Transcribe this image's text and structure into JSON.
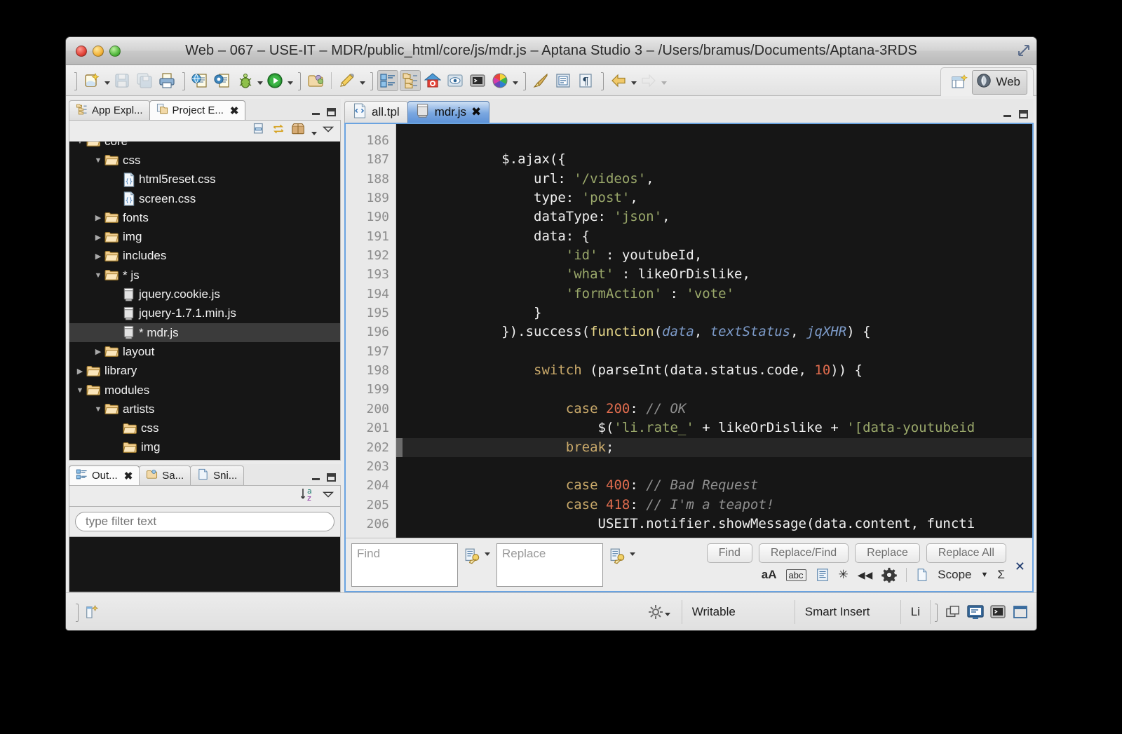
{
  "window": {
    "title": "Web – 067 – USE-IT – MDR/public_html/core/js/mdr.js – Aptana Studio 3 – /Users/bramus/Documents/Aptana-3RDS"
  },
  "toolbar": {
    "left_groups": [
      {
        "items": [
          {
            "name": "new-wizard-icon",
            "label": "New",
            "dropdown": true,
            "enabled": true
          },
          {
            "name": "save-icon",
            "label": "Save",
            "dropdown": false,
            "enabled": false
          },
          {
            "name": "save-all-icon",
            "label": "Save All",
            "dropdown": false,
            "enabled": false
          },
          {
            "name": "print-icon",
            "label": "Print",
            "dropdown": false,
            "enabled": true
          }
        ]
      },
      {
        "items": [
          {
            "name": "run-in-browser-icon",
            "label": "Run in Browser",
            "dropdown": false,
            "enabled": true
          },
          {
            "name": "preview-icon",
            "label": "Preview",
            "dropdown": false,
            "enabled": true
          },
          {
            "name": "debug-icon",
            "label": "Debug",
            "dropdown": true,
            "enabled": true
          },
          {
            "name": "run-icon",
            "label": "Run",
            "dropdown": true,
            "enabled": true
          }
        ]
      },
      {
        "items": [
          {
            "name": "open-resource-icon",
            "label": "Open Resource",
            "dropdown": false,
            "enabled": true
          }
        ]
      },
      {
        "items": [
          {
            "name": "pencil-icon",
            "label": "Edit",
            "dropdown": true,
            "enabled": true
          }
        ]
      },
      {
        "items": [
          {
            "name": "app-explorer-toggle-icon",
            "label": "App Explorer",
            "dropdown": false,
            "enabled": true,
            "pressed": true
          },
          {
            "name": "project-explorer-toggle-icon",
            "label": "Project Explorer",
            "dropdown": false,
            "enabled": true,
            "pressed": true
          },
          {
            "name": "home-icon",
            "label": "Studio Home",
            "dropdown": false,
            "enabled": true
          },
          {
            "name": "preview-pane-icon",
            "label": "Preview Pane",
            "dropdown": false,
            "enabled": true
          },
          {
            "name": "terminal-icon",
            "label": "Terminal",
            "dropdown": false,
            "enabled": true
          },
          {
            "name": "color-wheel-icon",
            "label": "Colors",
            "dropdown": true,
            "enabled": true
          }
        ]
      },
      {
        "items": [
          {
            "name": "brush-icon",
            "label": "Brush",
            "dropdown": false,
            "enabled": true
          },
          {
            "name": "book-icon",
            "label": "Snippets",
            "dropdown": false,
            "enabled": true
          },
          {
            "name": "pilcrow-icon",
            "label": "Show Whitespace",
            "dropdown": false,
            "enabled": true
          }
        ]
      },
      {
        "items": [
          {
            "name": "back-icon",
            "label": "Back",
            "dropdown": true,
            "enabled": true
          },
          {
            "name": "forward-icon",
            "label": "Forward",
            "dropdown": true,
            "enabled": false
          }
        ]
      }
    ],
    "perspective": {
      "open_perspective_icon": "open-perspective-icon",
      "active_label": "Web",
      "active_icon": "web-perspective-icon"
    }
  },
  "explorer": {
    "tabs": [
      {
        "label": "App Expl...",
        "icon": "app-explorer-icon",
        "active": false,
        "closable": false
      },
      {
        "label": "Project E...",
        "icon": "project-explorer-icon",
        "active": true,
        "closable": true
      }
    ],
    "view_toolbar": [
      {
        "name": "collapse-all-icon",
        "label": "Collapse All"
      },
      {
        "name": "link-with-editor-icon",
        "label": "Link with Editor"
      },
      {
        "name": "deploy-icon",
        "label": "Deploy",
        "dropdown": true
      },
      {
        "name": "view-menu-icon",
        "label": "View Menu"
      }
    ],
    "tree": [
      {
        "label": "core",
        "depth": 2,
        "type": "folder",
        "state": "expanded",
        "clipped": true
      },
      {
        "label": "css",
        "depth": 3,
        "type": "folder",
        "state": "expanded"
      },
      {
        "label": "html5reset.css",
        "depth": 4,
        "type": "css-file"
      },
      {
        "label": "screen.css",
        "depth": 4,
        "type": "css-file"
      },
      {
        "label": "fonts",
        "depth": 3,
        "type": "folder",
        "state": "collapsed"
      },
      {
        "label": "img",
        "depth": 3,
        "type": "folder",
        "state": "collapsed"
      },
      {
        "label": "includes",
        "depth": 3,
        "type": "folder",
        "state": "collapsed"
      },
      {
        "label": "* js",
        "depth": 3,
        "type": "folder",
        "state": "expanded"
      },
      {
        "label": "jquery.cookie.js",
        "depth": 4,
        "type": "js-file"
      },
      {
        "label": "jquery-1.7.1.min.js",
        "depth": 4,
        "type": "js-file"
      },
      {
        "label": "* mdr.js",
        "depth": 4,
        "type": "js-file",
        "selected": true
      },
      {
        "label": "layout",
        "depth": 3,
        "type": "folder",
        "state": "collapsed"
      },
      {
        "label": "library",
        "depth": 2,
        "type": "folder",
        "state": "collapsed"
      },
      {
        "label": "modules",
        "depth": 2,
        "type": "folder",
        "state": "expanded"
      },
      {
        "label": "artists",
        "depth": 3,
        "type": "folder",
        "state": "expanded"
      },
      {
        "label": "css",
        "depth": 4,
        "type": "folder",
        "state": "leaf"
      },
      {
        "label": "img",
        "depth": 4,
        "type": "folder",
        "state": "leaf",
        "clipped": true
      }
    ]
  },
  "outline": {
    "tabs": [
      {
        "label": "Out...",
        "icon": "outline-icon",
        "active": true,
        "closable": true
      },
      {
        "label": "Sa...",
        "icon": "samples-icon",
        "active": false,
        "closable": false
      },
      {
        "label": "Sni...",
        "icon": "snippets-icon",
        "active": false,
        "closable": false
      }
    ],
    "view_toolbar": [
      {
        "name": "sort-az-icon",
        "label": "Sort"
      },
      {
        "name": "view-menu-icon",
        "label": "View Menu"
      }
    ],
    "filter_placeholder": "type filter text",
    "filter_value": ""
  },
  "editor": {
    "tabs": [
      {
        "label": "all.tpl",
        "icon": "tpl-file-icon",
        "active": false,
        "closable": false
      },
      {
        "label": "mdr.js",
        "icon": "js-file-icon",
        "active": true,
        "closable": true
      }
    ],
    "first_line": 186,
    "highlighted_line": 202,
    "lines": [
      {
        "num": 186,
        "text": ""
      },
      {
        "num": 187,
        "text": "            $.ajax({"
      },
      {
        "num": 188,
        "text": "                url: '/videos',"
      },
      {
        "num": 189,
        "text": "                type: 'post',"
      },
      {
        "num": 190,
        "text": "                dataType: 'json',"
      },
      {
        "num": 191,
        "text": "                data: {"
      },
      {
        "num": 192,
        "text": "                    'id' : youtubeId,"
      },
      {
        "num": 193,
        "text": "                    'what' : likeOrDislike,"
      },
      {
        "num": 194,
        "text": "                    'formAction' : 'vote'"
      },
      {
        "num": 195,
        "text": "                }"
      },
      {
        "num": 196,
        "text": "            }).success(function(data, textStatus, jqXHR) {"
      },
      {
        "num": 197,
        "text": ""
      },
      {
        "num": 198,
        "text": "                switch (parseInt(data.status.code, 10)) {"
      },
      {
        "num": 199,
        "text": ""
      },
      {
        "num": 200,
        "text": "                    case 200: // OK"
      },
      {
        "num": 201,
        "text": "                        $('li.rate_' + likeOrDislike + '[data-youtubeid"
      },
      {
        "num": 202,
        "text": "                    break;"
      },
      {
        "num": 203,
        "text": ""
      },
      {
        "num": 204,
        "text": "                    case 400: // Bad Request"
      },
      {
        "num": 205,
        "text": "                    case 418: // I'm a teapot!"
      },
      {
        "num": 206,
        "text": "                        USEIT.notifier.showMessage(data.content, functi"
      }
    ]
  },
  "find": {
    "find_placeholder": "Find",
    "find_value": "",
    "replace_placeholder": "Replace",
    "replace_value": "",
    "buttons": [
      {
        "label": "Find",
        "name": "find-button"
      },
      {
        "label": "Replace/Find",
        "name": "replace-find-button"
      },
      {
        "label": "Replace",
        "name": "replace-button"
      },
      {
        "label": "Replace All",
        "name": "replace-all-button"
      }
    ],
    "options": [
      {
        "name": "case-sensitive-icon",
        "glyph": "aA"
      },
      {
        "name": "whole-word-icon",
        "glyph": "abc"
      },
      {
        "name": "search-in-selection-icon",
        "glyph": "▤"
      },
      {
        "name": "regex-icon",
        "glyph": "✳"
      },
      {
        "name": "search-backward-icon",
        "glyph": "◀◀"
      },
      {
        "name": "find-options-icon",
        "glyph": "⚙"
      }
    ],
    "scope_label": "Scope",
    "scope_sigma": "Σ",
    "close_glyph": "✕"
  },
  "statusbar": {
    "left_icon": "editor-marker-icon",
    "settings_icon": "settings-gear-icon",
    "cells": [
      "Writable",
      "Smart Insert",
      "Li"
    ],
    "right_icons": [
      {
        "name": "restore-views-icon"
      },
      {
        "name": "show-console-icon"
      },
      {
        "name": "show-terminal-icon"
      },
      {
        "name": "maximize-view-icon"
      }
    ]
  },
  "colors": {
    "accent": "#6aa3e0",
    "editor_bg": "#161616",
    "active_tab": "#5e93d8",
    "selection": "#3b3b3b"
  }
}
